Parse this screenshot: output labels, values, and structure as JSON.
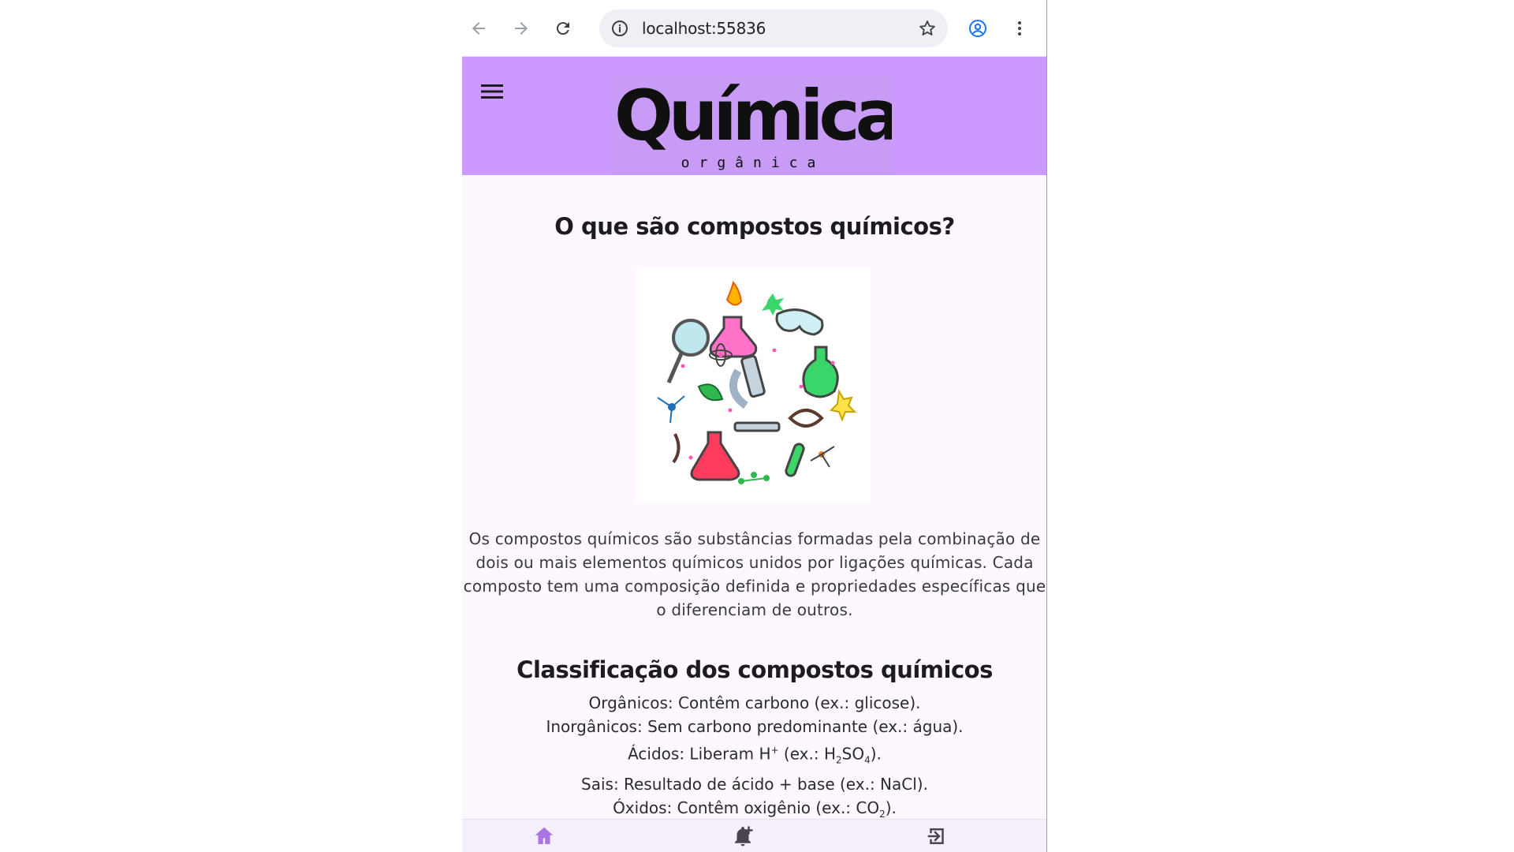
{
  "browser": {
    "url": "localhost:55836"
  },
  "app": {
    "logo": {
      "title": "Química",
      "subtitle": "orgânica"
    },
    "accent": "#cc99ff",
    "nav_accent": "#8b43d9"
  },
  "content": {
    "heading": "O que são compostos químicos?",
    "paragraph": "Os compostos químicos são substâncias formadas pela combinação de dois ou mais elementos químicos unidos por ligações químicas. Cada composto tem uma composição definida e propriedades específicas que o diferenciam de outros.",
    "classification_heading": "Classificação dos compostos químicos",
    "classes": {
      "organic": "Orgânicos: Contêm carbono (ex.: glicose).",
      "inorganic": "Inorgânicos: Sem carbono predominante (ex.: água).",
      "acids_prefix": "Ácidos: Liberam H",
      "acids_sup": "+",
      "acids_mid": " (ex.: H",
      "acids_sub1": "2",
      "acids_mid2": "SO",
      "acids_sub2": "4",
      "acids_end": ").",
      "salts": "Sais: Resultado de ácido + base (ex.: NaCl).",
      "oxides_prefix": "Óxidos: Contêm oxigênio (ex.: CO",
      "oxides_sub": "2",
      "oxides_end": ")."
    }
  },
  "bottom_nav": {
    "items": [
      {
        "icon": "home-icon"
      },
      {
        "icon": "notification-add-icon"
      },
      {
        "icon": "logout-icon"
      }
    ]
  }
}
